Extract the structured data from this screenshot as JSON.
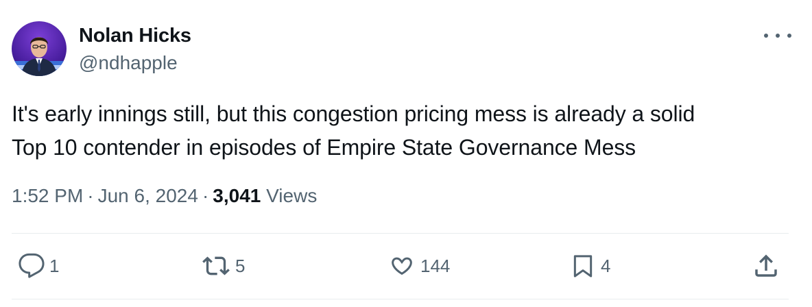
{
  "author": {
    "name": "Nolan Hicks",
    "handle": "@ndhapple"
  },
  "tweet": {
    "text_line1": "It's early innings still, but this congestion pricing mess is already a solid",
    "text_line2": "Top 10 contender in episodes of Empire State Governance Mess"
  },
  "meta": {
    "time": "1:52 PM",
    "date": "Jun 6, 2024",
    "views_count": "3,041",
    "views_label": "Views",
    "separator": "·"
  },
  "actions": {
    "replies": "1",
    "reposts": "5",
    "likes": "144",
    "bookmarks": "4"
  },
  "icons": {
    "more": "more-icon",
    "reply": "reply-icon",
    "repost": "repost-icon",
    "like": "heart-icon",
    "bookmark": "bookmark-icon",
    "share": "share-icon"
  },
  "colors": {
    "text": "#0f1419",
    "secondary": "#536471",
    "divider": "#e8ecee"
  }
}
